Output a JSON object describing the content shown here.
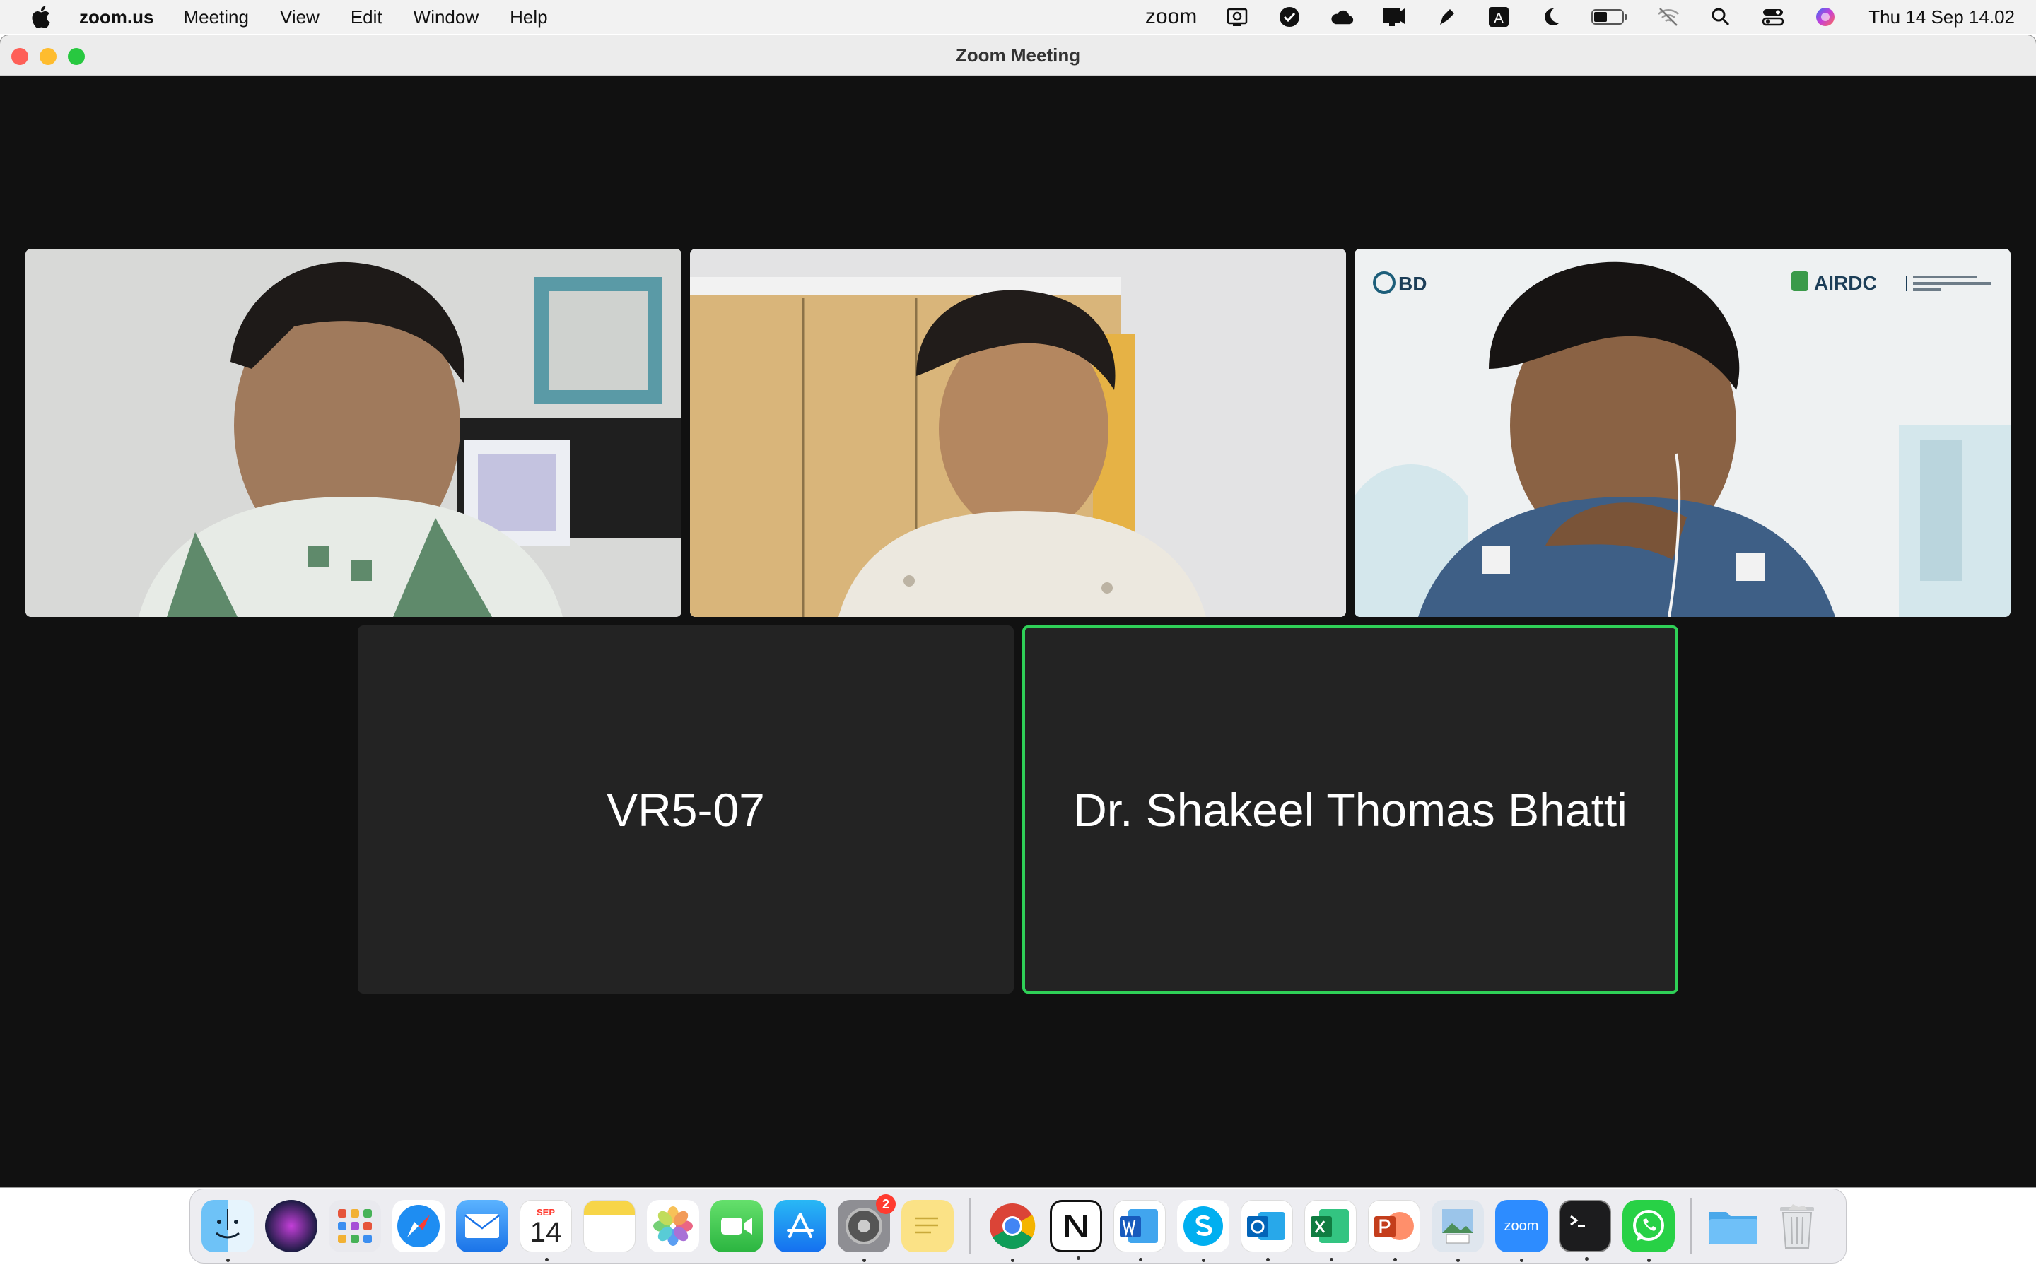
{
  "menubar": {
    "app_name": "zoom.us",
    "items": [
      "Meeting",
      "View",
      "Edit",
      "Window",
      "Help"
    ],
    "zoom_wordmark": "zoom",
    "input_source": "A",
    "clock": "Thu 14 Sep  14.02"
  },
  "window": {
    "title": "Zoom Meeting"
  },
  "video_tiles": [
    {
      "name": "participant-video-1"
    },
    {
      "name": "participant-video-2"
    },
    {
      "name": "participant-video-3",
      "logos": [
        "BD",
        "AIRDC"
      ]
    }
  ],
  "name_tiles": [
    {
      "label": "VR5-07",
      "active": false
    },
    {
      "label": "Dr. Shakeel Thomas Bhatti",
      "active": true
    }
  ],
  "dock": {
    "calendar_month": "SEP",
    "calendar_day": "14",
    "settings_badge": "2",
    "zoom_label": "zoom",
    "apps": [
      "finder",
      "siri",
      "launchpad",
      "safari",
      "mail",
      "calendar",
      "notes",
      "photos",
      "facetime",
      "app-store",
      "system-preferences",
      "stickies",
      "chrome",
      "notion",
      "word",
      "skype",
      "outlook",
      "excel",
      "powerpoint",
      "preview",
      "zoom",
      "terminal",
      "whatsapp",
      "folder",
      "trash"
    ]
  }
}
